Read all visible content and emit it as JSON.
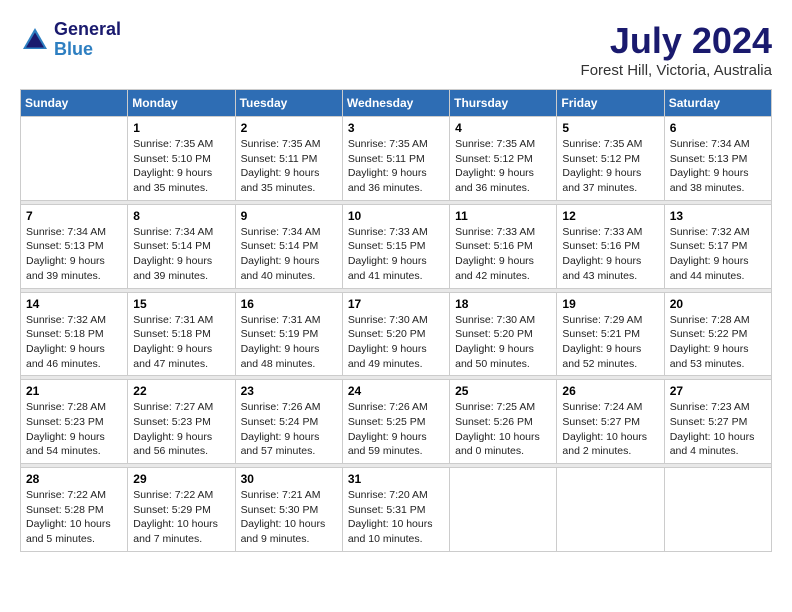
{
  "header": {
    "logo_line1": "General",
    "logo_line2": "Blue",
    "month": "July 2024",
    "location": "Forest Hill, Victoria, Australia"
  },
  "weekdays": [
    "Sunday",
    "Monday",
    "Tuesday",
    "Wednesday",
    "Thursday",
    "Friday",
    "Saturday"
  ],
  "weeks": [
    [
      {
        "day": "",
        "info": ""
      },
      {
        "day": "1",
        "info": "Sunrise: 7:35 AM\nSunset: 5:10 PM\nDaylight: 9 hours\nand 35 minutes."
      },
      {
        "day": "2",
        "info": "Sunrise: 7:35 AM\nSunset: 5:11 PM\nDaylight: 9 hours\nand 35 minutes."
      },
      {
        "day": "3",
        "info": "Sunrise: 7:35 AM\nSunset: 5:11 PM\nDaylight: 9 hours\nand 36 minutes."
      },
      {
        "day": "4",
        "info": "Sunrise: 7:35 AM\nSunset: 5:12 PM\nDaylight: 9 hours\nand 36 minutes."
      },
      {
        "day": "5",
        "info": "Sunrise: 7:35 AM\nSunset: 5:12 PM\nDaylight: 9 hours\nand 37 minutes."
      },
      {
        "day": "6",
        "info": "Sunrise: 7:34 AM\nSunset: 5:13 PM\nDaylight: 9 hours\nand 38 minutes."
      }
    ],
    [
      {
        "day": "7",
        "info": "Sunrise: 7:34 AM\nSunset: 5:13 PM\nDaylight: 9 hours\nand 39 minutes."
      },
      {
        "day": "8",
        "info": "Sunrise: 7:34 AM\nSunset: 5:14 PM\nDaylight: 9 hours\nand 39 minutes."
      },
      {
        "day": "9",
        "info": "Sunrise: 7:34 AM\nSunset: 5:14 PM\nDaylight: 9 hours\nand 40 minutes."
      },
      {
        "day": "10",
        "info": "Sunrise: 7:33 AM\nSunset: 5:15 PM\nDaylight: 9 hours\nand 41 minutes."
      },
      {
        "day": "11",
        "info": "Sunrise: 7:33 AM\nSunset: 5:16 PM\nDaylight: 9 hours\nand 42 minutes."
      },
      {
        "day": "12",
        "info": "Sunrise: 7:33 AM\nSunset: 5:16 PM\nDaylight: 9 hours\nand 43 minutes."
      },
      {
        "day": "13",
        "info": "Sunrise: 7:32 AM\nSunset: 5:17 PM\nDaylight: 9 hours\nand 44 minutes."
      }
    ],
    [
      {
        "day": "14",
        "info": "Sunrise: 7:32 AM\nSunset: 5:18 PM\nDaylight: 9 hours\nand 46 minutes."
      },
      {
        "day": "15",
        "info": "Sunrise: 7:31 AM\nSunset: 5:18 PM\nDaylight: 9 hours\nand 47 minutes."
      },
      {
        "day": "16",
        "info": "Sunrise: 7:31 AM\nSunset: 5:19 PM\nDaylight: 9 hours\nand 48 minutes."
      },
      {
        "day": "17",
        "info": "Sunrise: 7:30 AM\nSunset: 5:20 PM\nDaylight: 9 hours\nand 49 minutes."
      },
      {
        "day": "18",
        "info": "Sunrise: 7:30 AM\nSunset: 5:20 PM\nDaylight: 9 hours\nand 50 minutes."
      },
      {
        "day": "19",
        "info": "Sunrise: 7:29 AM\nSunset: 5:21 PM\nDaylight: 9 hours\nand 52 minutes."
      },
      {
        "day": "20",
        "info": "Sunrise: 7:28 AM\nSunset: 5:22 PM\nDaylight: 9 hours\nand 53 minutes."
      }
    ],
    [
      {
        "day": "21",
        "info": "Sunrise: 7:28 AM\nSunset: 5:23 PM\nDaylight: 9 hours\nand 54 minutes."
      },
      {
        "day": "22",
        "info": "Sunrise: 7:27 AM\nSunset: 5:23 PM\nDaylight: 9 hours\nand 56 minutes."
      },
      {
        "day": "23",
        "info": "Sunrise: 7:26 AM\nSunset: 5:24 PM\nDaylight: 9 hours\nand 57 minutes."
      },
      {
        "day": "24",
        "info": "Sunrise: 7:26 AM\nSunset: 5:25 PM\nDaylight: 9 hours\nand 59 minutes."
      },
      {
        "day": "25",
        "info": "Sunrise: 7:25 AM\nSunset: 5:26 PM\nDaylight: 10 hours\nand 0 minutes."
      },
      {
        "day": "26",
        "info": "Sunrise: 7:24 AM\nSunset: 5:27 PM\nDaylight: 10 hours\nand 2 minutes."
      },
      {
        "day": "27",
        "info": "Sunrise: 7:23 AM\nSunset: 5:27 PM\nDaylight: 10 hours\nand 4 minutes."
      }
    ],
    [
      {
        "day": "28",
        "info": "Sunrise: 7:22 AM\nSunset: 5:28 PM\nDaylight: 10 hours\nand 5 minutes."
      },
      {
        "day": "29",
        "info": "Sunrise: 7:22 AM\nSunset: 5:29 PM\nDaylight: 10 hours\nand 7 minutes."
      },
      {
        "day": "30",
        "info": "Sunrise: 7:21 AM\nSunset: 5:30 PM\nDaylight: 10 hours\nand 9 minutes."
      },
      {
        "day": "31",
        "info": "Sunrise: 7:20 AM\nSunset: 5:31 PM\nDaylight: 10 hours\nand 10 minutes."
      },
      {
        "day": "",
        "info": ""
      },
      {
        "day": "",
        "info": ""
      },
      {
        "day": "",
        "info": ""
      }
    ]
  ]
}
